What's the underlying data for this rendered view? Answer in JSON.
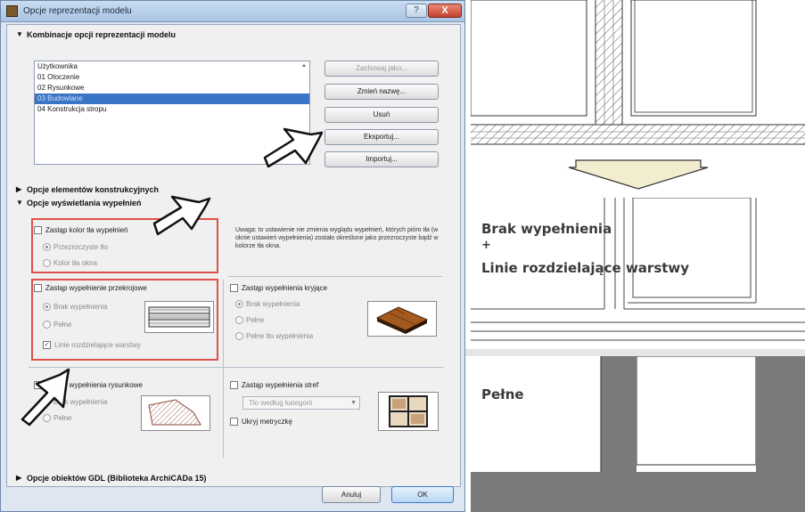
{
  "window": {
    "title": "Opcje reprezentacji modelu",
    "help_label": "?",
    "close_label": "X"
  },
  "sections": {
    "combinations": "Kombinacje opcji reprezentacji modelu",
    "structural": "Opcje elementów konstrukcyjnych",
    "fill_display": "Opcje wyświetlania wypełnień",
    "gdl": "Opcje obiektów GDL (Biblioteka ArchiCADa 15)"
  },
  "combinations_list": {
    "items": [
      "Użytkownika",
      "01 Otoczenie",
      "02 Rysunkowe",
      "03 Budowlane",
      "04 Konstrukcja stropu"
    ],
    "selected_index": 3
  },
  "side_buttons": {
    "save_as": "Zachowaj jako...",
    "rename": "Zmień nazwę...",
    "delete": "Usuń",
    "export": "Eksportuj...",
    "import": "Importuj..."
  },
  "fill_options": {
    "override_bg_color": "Zastąp kolor tła wypełnień",
    "transparent_bg": "Przezroczyste tło",
    "window_bg_color": "Kolor tła okna",
    "note": "Uwaga: to ustawienie nie zmienia wyglądu wypełnień, których pióro tła (w oknie ustawień wypełnienia) zostało określone jako przezroczyste bądź w kolorze tła okna.",
    "override_cut_fill": "Zastąp wypełnienie przekrojowe",
    "cut_no_fill": "Brak wypełnienia",
    "cut_solid": "Pełne",
    "separator_lines": "Linie rozdzielające warstwy",
    "override_cover_fill": "Zastąp wypełnienia kryjące",
    "cover_no_fill": "Brak wypełnienia",
    "cover_solid": "Pełne",
    "cover_bg_solid": "Pełne tło wypełnienia",
    "override_drafting_fill": "Zastąp wypełnienia rysunkowe",
    "draft_no_fill": "Brak wypełnienia",
    "draft_solid": "Pełne",
    "override_zone_fill": "Zastąp wypełnienia stref",
    "zone_combo_value": "Tło według kategorii",
    "hide_metric": "Ukryj metryczkę"
  },
  "footer": {
    "cancel": "Anuluj",
    "ok": "OK"
  },
  "diagrams": {
    "label_none_fill": "Brak wypełnienia",
    "label_plus": "+",
    "label_separator": "Linie rozdzielające warstwy",
    "label_solid": "Pełne"
  },
  "colors": {
    "selection": "#3b75c8",
    "highlight_border": "#e0504a",
    "wall_fill": "#7a7a7a",
    "dialog_bg": "#dde6f1"
  },
  "icons": {
    "help": "question-icon",
    "close": "close-icon",
    "section_toggle": "triangle-icon"
  }
}
